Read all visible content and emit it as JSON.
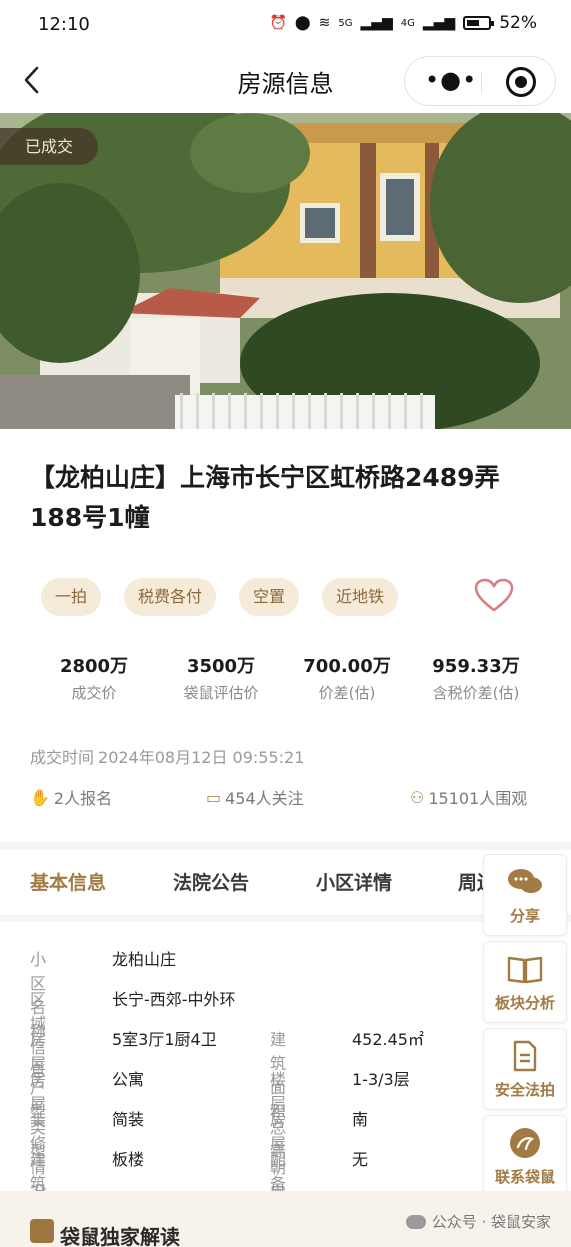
{
  "status_bar": {
    "time": "12:10",
    "signal_1": "5G",
    "signal_2": "4G",
    "battery": "52%"
  },
  "nav": {
    "title": "房源信息",
    "back_icon": "back-chevron-icon",
    "more_icon": "more-dots-icon",
    "record_icon": "target-icon"
  },
  "hero": {
    "badge": "已成交"
  },
  "property": {
    "title": "【龙柏山庄】上海市长宁区虹桥路2489弄188号1幢",
    "tags": [
      "一拍",
      "税费各付",
      "空置",
      "近地铁"
    ],
    "favorite_icon": "heart-icon",
    "stats": [
      {
        "value": "2800万",
        "label": "成交价"
      },
      {
        "value": "3500万",
        "label": "袋鼠评估价"
      },
      {
        "value": "700.00万",
        "label": "价差(估)"
      },
      {
        "value": "959.33万",
        "label": "含税价差(估)"
      }
    ],
    "deal_time_label": "成交时间",
    "deal_time": "2024年08月12日 09:55:21",
    "counters": [
      {
        "icon": "hand-icon",
        "text": "2人报名"
      },
      {
        "icon": "vr-glasses-icon",
        "text": "454人关注"
      },
      {
        "icon": "people-icon",
        "text": "15101人围观"
      }
    ]
  },
  "tabs": [
    "基本信息",
    "法院公告",
    "小区详情",
    "周边"
  ],
  "basic_info": {
    "rows": [
      {
        "k": "小区名称",
        "v": "龙柏山庄"
      },
      {
        "k": "区域信息",
        "v": "长宁-西郊-中外环"
      },
      {
        "k": "房屋户型",
        "v": "5室3厅1厨4卫",
        "k2": "建筑面积",
        "v2": "452.45㎡"
      },
      {
        "k": "房屋类型",
        "v": "公寓",
        "k2": "楼层总高",
        "v2": "1-3/3层"
      },
      {
        "k": "装修情况",
        "v": "简装",
        "k2": "房屋朝向",
        "v2": "南"
      },
      {
        "k": "建筑类型",
        "v": "板楼",
        "k2": "配备电梯",
        "v2": "无"
      }
    ]
  },
  "side_buttons": [
    {
      "label": "分享",
      "icon": "chat-bubbles-icon"
    },
    {
      "label": "板块分析",
      "icon": "book-icon"
    },
    {
      "label": "安全法拍",
      "icon": "document-icon"
    },
    {
      "label": "联系袋鼠",
      "icon": "kangaroo-logo-icon"
    }
  ],
  "bottom": {
    "title": "袋鼠独家解读",
    "watermark": "公众号 · 袋鼠安家"
  },
  "colors": {
    "accent": "#a17b43",
    "tag_bg": "#f6ead8",
    "heart": "#d97e7e"
  }
}
